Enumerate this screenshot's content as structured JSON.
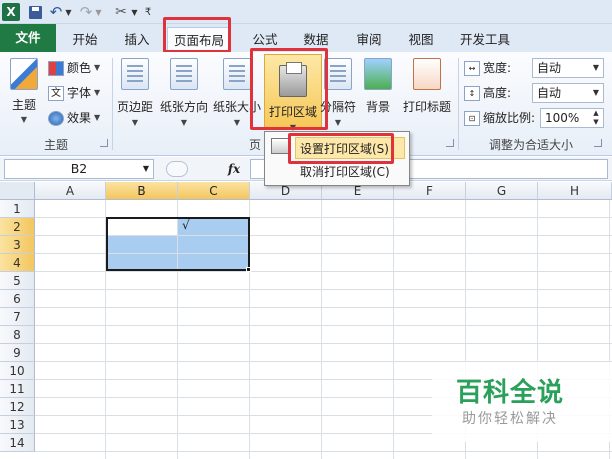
{
  "quick_access": {
    "app_icon": "excel-icon",
    "icons": [
      "save-icon",
      "undo-icon",
      "redo-icon",
      "tools-icon"
    ]
  },
  "tabs": [
    {
      "label": "文件"
    },
    {
      "label": "开始"
    },
    {
      "label": "插入"
    },
    {
      "label": "页面布局"
    },
    {
      "label": "公式"
    },
    {
      "label": "数据"
    },
    {
      "label": "审阅"
    },
    {
      "label": "视图"
    },
    {
      "label": "开发工具"
    }
  ],
  "active_tab": "页面布局",
  "ribbon": {
    "themes": {
      "themes_label": "主题",
      "colors_label": "颜色",
      "fonts_label": "字体",
      "effects_label": "效果",
      "group_label": "主题"
    },
    "page_setup": {
      "margins_label": "页边距",
      "orientation_label": "纸张方向",
      "size_label": "纸张大小",
      "print_area_label": "打印区域",
      "breaks_label": "分隔符",
      "background_label": "背景",
      "print_titles_label": "打印标题",
      "group_label": "页"
    },
    "scale_to_fit": {
      "width_label": "宽度:",
      "width_value": "自动",
      "height_label": "高度:",
      "height_value": "自动",
      "scale_label": "缩放比例:",
      "scale_value": "100%",
      "group_label": "调整为合适大小"
    }
  },
  "formula_bar": {
    "name_box": "B2",
    "fx_label": "fx",
    "formula": ""
  },
  "print_area_menu": {
    "set_label": "设置打印区域(S)",
    "clear_label": "取消打印区域(C)"
  },
  "sheet": {
    "columns": [
      "A",
      "B",
      "C",
      "D",
      "E",
      "F",
      "G",
      "H"
    ],
    "rows": [
      "1",
      "2",
      "3",
      "4",
      "5",
      "6",
      "7",
      "8",
      "9",
      "10",
      "11",
      "12",
      "13",
      "14"
    ],
    "c2_value": "√"
  },
  "watermark": {
    "title": "百科全说",
    "subtitle": "助你轻松解决"
  },
  "colors": {
    "file_tab": "#1f7a43",
    "highlight_box": "#e0323a",
    "selection_fill": "#a8cdf0",
    "header_selected": "#f3c65e",
    "watermark_green": "#2aa05a"
  }
}
